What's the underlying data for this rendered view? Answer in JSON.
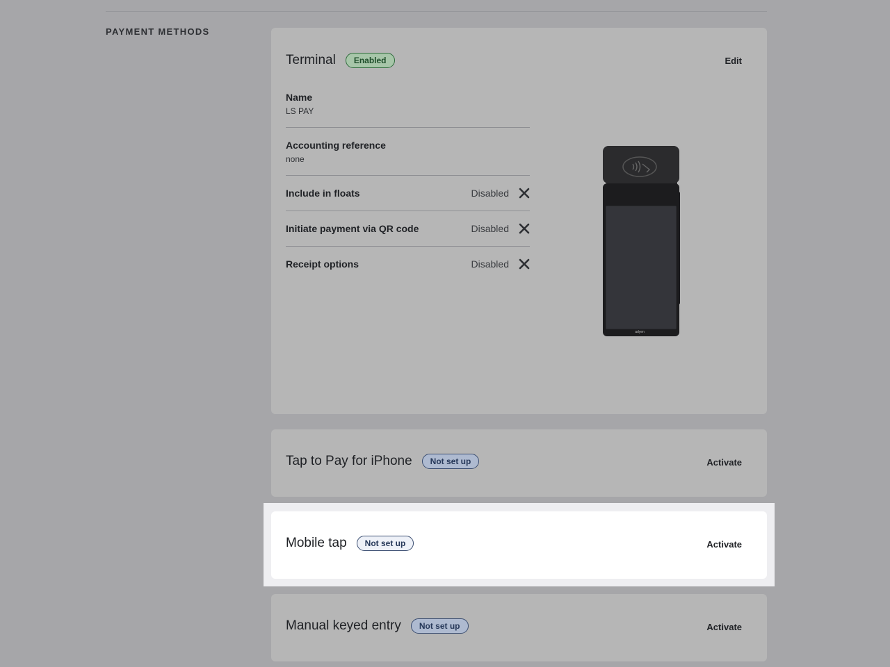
{
  "section": {
    "title": "PAYMENT METHODS"
  },
  "terminal": {
    "title": "Terminal",
    "badge": "Enabled",
    "action": "Edit",
    "fields": [
      {
        "label": "Name",
        "value": "LS PAY"
      },
      {
        "label": "Accounting reference",
        "value": "none"
      }
    ],
    "settings": [
      {
        "label": "Include in floats",
        "status": "Disabled",
        "icon": "close-icon"
      },
      {
        "label": "Initiate payment via QR code",
        "status": "Disabled",
        "icon": "close-icon"
      },
      {
        "label": "Receipt options",
        "status": "Disabled",
        "icon": "close-icon"
      }
    ],
    "device_image": "payment-terminal-image",
    "device_brand": "adyen"
  },
  "tap_to_pay": {
    "title": "Tap to Pay for iPhone",
    "badge": "Not set up",
    "action": "Activate"
  },
  "mobile_tap": {
    "title": "Mobile tap",
    "badge": "Not set up",
    "action": "Activate"
  },
  "manual_entry": {
    "title": "Manual keyed entry",
    "badge": "Not set up",
    "action": "Activate"
  },
  "colors": {
    "page_bg": "#a6a6a9",
    "card_bg": "#b6b6b6",
    "highlight_bg": "#eeeef1",
    "highlight_card_bg": "#ffffff",
    "enabled_badge": "#2f6b3c",
    "notset_badge": "#3b4e71"
  }
}
